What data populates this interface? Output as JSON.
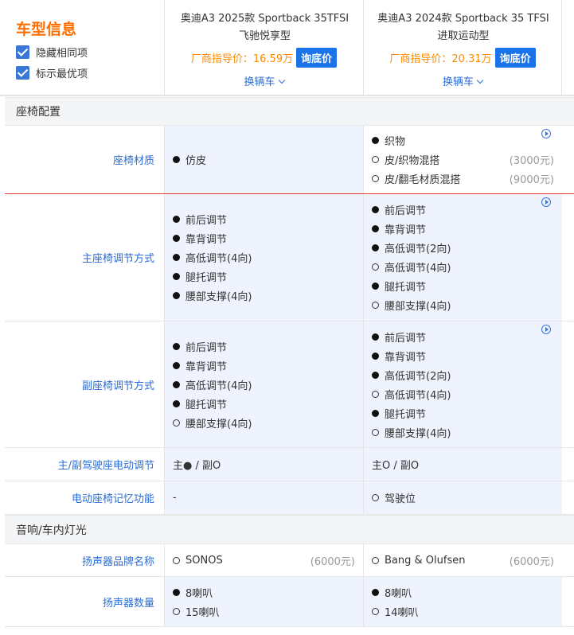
{
  "header": {
    "title": "车型信息",
    "hide_same": "隐藏相同项",
    "mark_best": "标示最优项",
    "cars": [
      {
        "name": "奥迪A3 2025款 Sportback 35TFSI 飞驰悦享型",
        "price_label": "厂商指导价：16.59万",
        "inquiry": "询底价",
        "switch": "换辆车"
      },
      {
        "name": "奥迪A3 2024款 Sportback 35 TFSI 进取运动型",
        "price_label": "厂商指导价：20.31万",
        "inquiry": "询底价",
        "switch": "换辆车"
      }
    ]
  },
  "sections": {
    "seat": "座椅配置",
    "audio": "音响/车内灯光"
  },
  "rows": {
    "seat_material": {
      "label": "座椅材质",
      "c1": [
        {
          "text": "仿皮",
          "on": true
        }
      ],
      "c2": [
        {
          "text": "织物",
          "on": true
        },
        {
          "text": "皮/织物混搭",
          "on": false,
          "extra": "(3000元)"
        },
        {
          "text": "皮/翻毛材质混搭",
          "on": false,
          "extra": "(9000元)"
        }
      ]
    },
    "main_seat": {
      "label": "主座椅调节方式",
      "c1": [
        {
          "text": "前后调节",
          "on": true
        },
        {
          "text": "靠背调节",
          "on": true
        },
        {
          "text": "高低调节(4向)",
          "on": true
        },
        {
          "text": "腿托调节",
          "on": true
        },
        {
          "text": "腰部支撑(4向)",
          "on": true
        }
      ],
      "c2": [
        {
          "text": "前后调节",
          "on": true
        },
        {
          "text": "靠背调节",
          "on": true
        },
        {
          "text": "高低调节(2向)",
          "on": true
        },
        {
          "text": "高低调节(4向)",
          "on": false
        },
        {
          "text": "腿托调节",
          "on": true
        },
        {
          "text": "腰部支撑(4向)",
          "on": false
        }
      ]
    },
    "pass_seat": {
      "label": "副座椅调节方式",
      "c1": [
        {
          "text": "前后调节",
          "on": true
        },
        {
          "text": "靠背调节",
          "on": true
        },
        {
          "text": "高低调节(4向)",
          "on": true
        },
        {
          "text": "腿托调节",
          "on": true
        },
        {
          "text": "腰部支撑(4向)",
          "on": false
        }
      ],
      "c2": [
        {
          "text": "前后调节",
          "on": true
        },
        {
          "text": "靠背调节",
          "on": true
        },
        {
          "text": "高低调节(2向)",
          "on": true
        },
        {
          "text": "高低调节(4向)",
          "on": false
        },
        {
          "text": "腿托调节",
          "on": true
        },
        {
          "text": "腰部支撑(4向)",
          "on": false
        }
      ]
    },
    "power_seat": {
      "label": "主/副驾驶座电动调节",
      "c1": "主● / 副O",
      "c2": "主O / 副O"
    },
    "memory": {
      "label": "电动座椅记忆功能",
      "c1": "-",
      "c2": [
        {
          "text": "驾驶位",
          "on": false
        }
      ]
    },
    "speaker_brand": {
      "label": "扬声器品牌名称",
      "c1": [
        {
          "text": "SONOS",
          "on": false,
          "extra": "(6000元)"
        }
      ],
      "c2": [
        {
          "text": "Bang & Olufsen",
          "on": false,
          "extra": "(6000元)"
        }
      ]
    },
    "speaker_count": {
      "label": "扬声器数量",
      "c1": [
        {
          "text": "8喇叭",
          "on": true
        },
        {
          "text": "15喇叭",
          "on": false
        }
      ],
      "c2": [
        {
          "text": "8喇叭",
          "on": true
        },
        {
          "text": "14喇叭",
          "on": false
        }
      ]
    }
  }
}
